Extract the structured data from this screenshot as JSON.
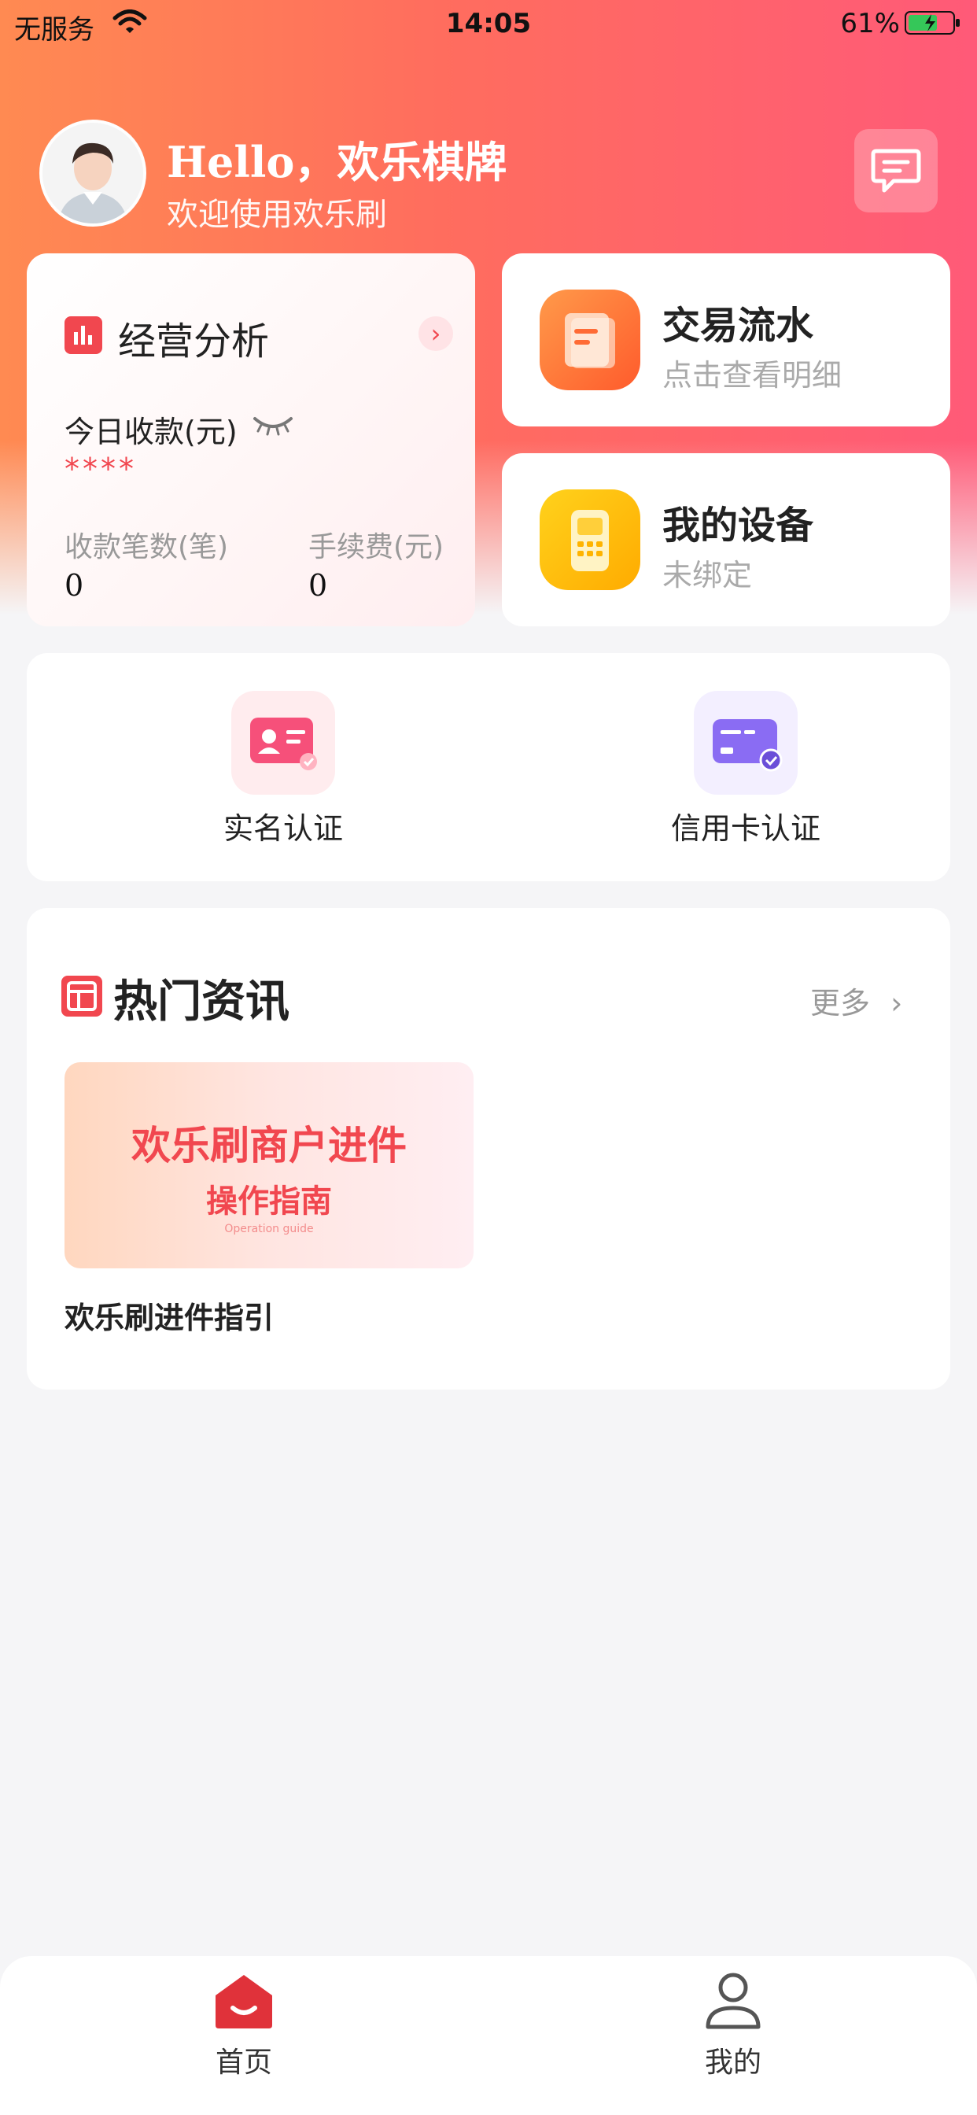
{
  "status_bar": {
    "carrier": "无服务",
    "time": "14:05",
    "battery": "61%"
  },
  "header": {
    "greeting": "Hello，欢乐棋牌",
    "subtitle": "欢迎使用欢乐刷"
  },
  "analysis": {
    "title": "经营分析",
    "today_label": "今日收款(元)",
    "today_value": "****",
    "count_label": "收款笔数(笔)",
    "count_value": "0",
    "fee_label": "手续费(元)",
    "fee_value": "0"
  },
  "transactions": {
    "title": "交易流水",
    "subtitle": "点击查看明细"
  },
  "device": {
    "title": "我的设备",
    "subtitle": "未绑定"
  },
  "auth": {
    "realname": "实名认证",
    "credit": "信用卡认证"
  },
  "news": {
    "title": "热门资讯",
    "more": "更多",
    "banner_line1": "欢乐刷商户进件",
    "banner_line2": "操作指南",
    "banner_line3": "Operation guide",
    "caption": "欢乐刷进件指引"
  },
  "tabs": {
    "home": "首页",
    "mine": "我的"
  },
  "colors": {
    "accent": "#f1474f",
    "gradient_start": "#ff8a52",
    "gradient_end": "#ff5a78"
  }
}
